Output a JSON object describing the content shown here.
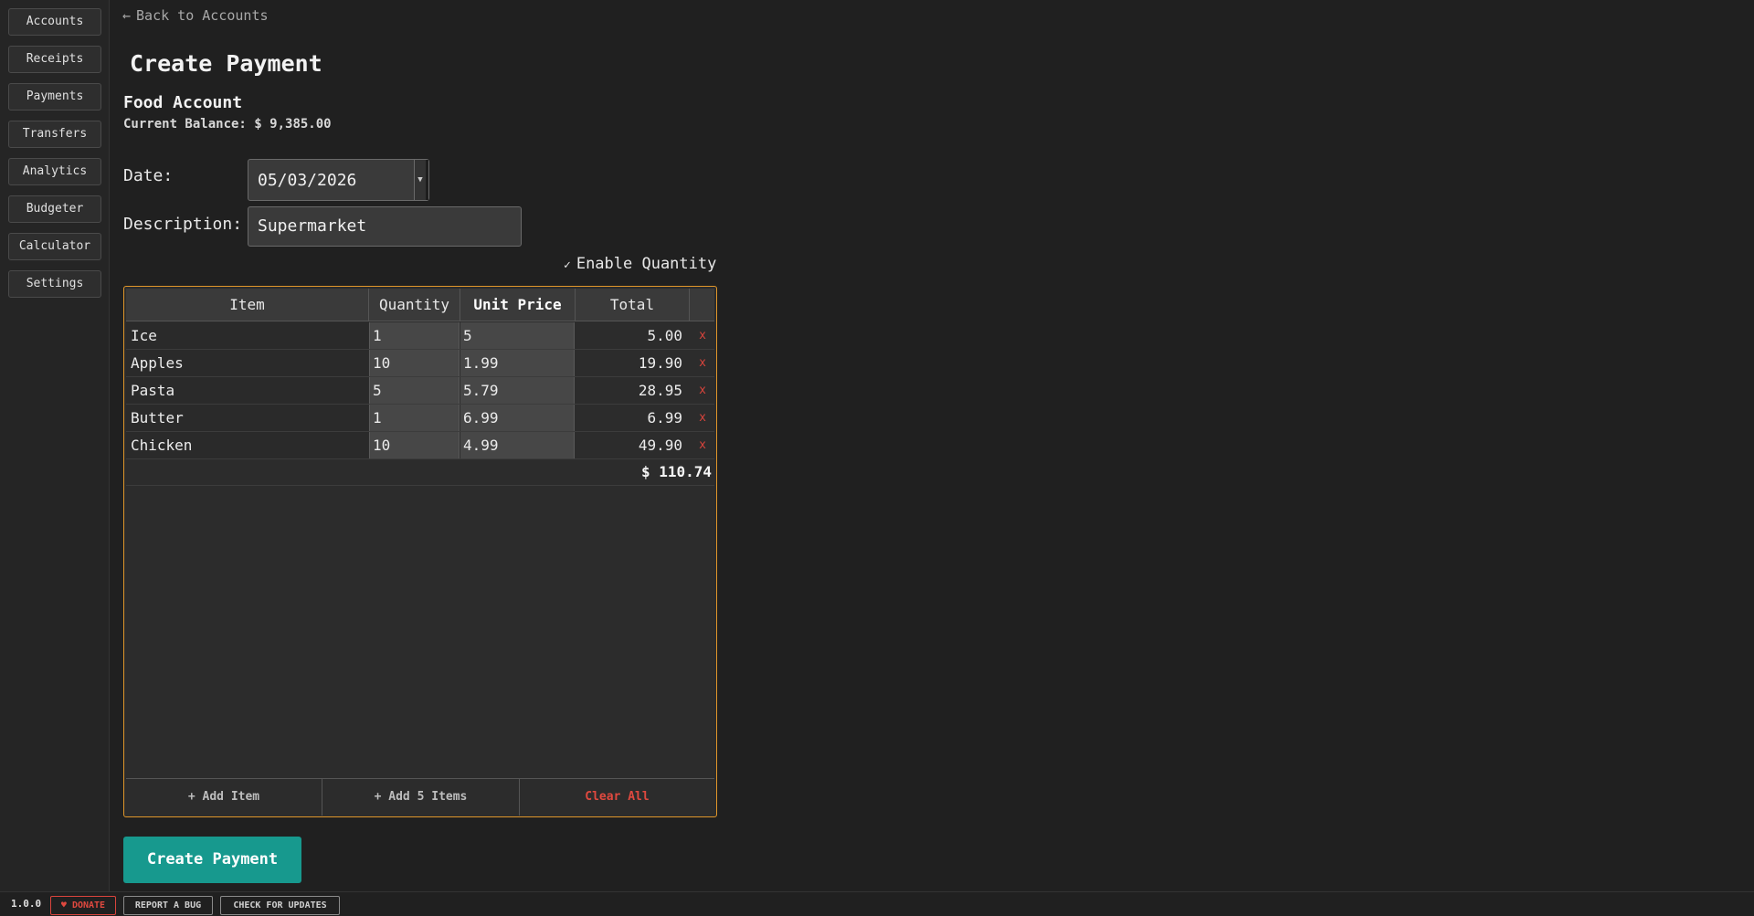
{
  "sidebar": {
    "items": [
      {
        "label": "Accounts"
      },
      {
        "label": "Receipts"
      },
      {
        "label": "Payments"
      },
      {
        "label": "Transfers"
      },
      {
        "label": "Analytics"
      },
      {
        "label": "Budgeter"
      },
      {
        "label": "Calculator"
      },
      {
        "label": "Settings"
      }
    ]
  },
  "header": {
    "back_label": "Back to Accounts",
    "title": "Create Payment"
  },
  "account": {
    "name": "Food Account",
    "balance_label": "Current Balance:",
    "balance_value": "$ 9,385.00"
  },
  "form": {
    "date_label": "Date:",
    "date_value": "05/03/2026",
    "description_label": "Description:",
    "description_value": "Supermarket",
    "enable_quantity_label": "Enable Quantity",
    "enable_quantity_checked": true
  },
  "table": {
    "columns": [
      "Item",
      "Quantity",
      "Unit Price",
      "Total"
    ],
    "rows": [
      {
        "item": "Ice",
        "quantity": "1",
        "unit_price": "5",
        "total": "5.00",
        "delete": "x"
      },
      {
        "item": "Apples",
        "quantity": "10",
        "unit_price": "1.99",
        "total": "19.90",
        "delete": "x"
      },
      {
        "item": "Pasta",
        "quantity": "5",
        "unit_price": "5.79",
        "total": "28.95",
        "delete": "x"
      },
      {
        "item": "Butter",
        "quantity": "1",
        "unit_price": "6.99",
        "total": "6.99",
        "delete": "x"
      },
      {
        "item": "Chicken",
        "quantity": "10",
        "unit_price": "4.99",
        "total": "49.90",
        "delete": "x"
      }
    ],
    "grand_total": "$ 110.74",
    "footer": {
      "add_item": "+ Add Item",
      "add_5_items": "+ Add 5 Items",
      "clear_all": "Clear All"
    }
  },
  "actions": {
    "create_label": "Create Payment"
  },
  "statusbar": {
    "version": "1.0.0",
    "donate": "♥ DONATE",
    "report_bug": "REPORT A BUG",
    "check_updates": "CHECK FOR UPDATES"
  },
  "colors": {
    "accent_teal": "#17998e",
    "panel_border_orange": "#e0962a",
    "danger_red": "#d9443c"
  }
}
